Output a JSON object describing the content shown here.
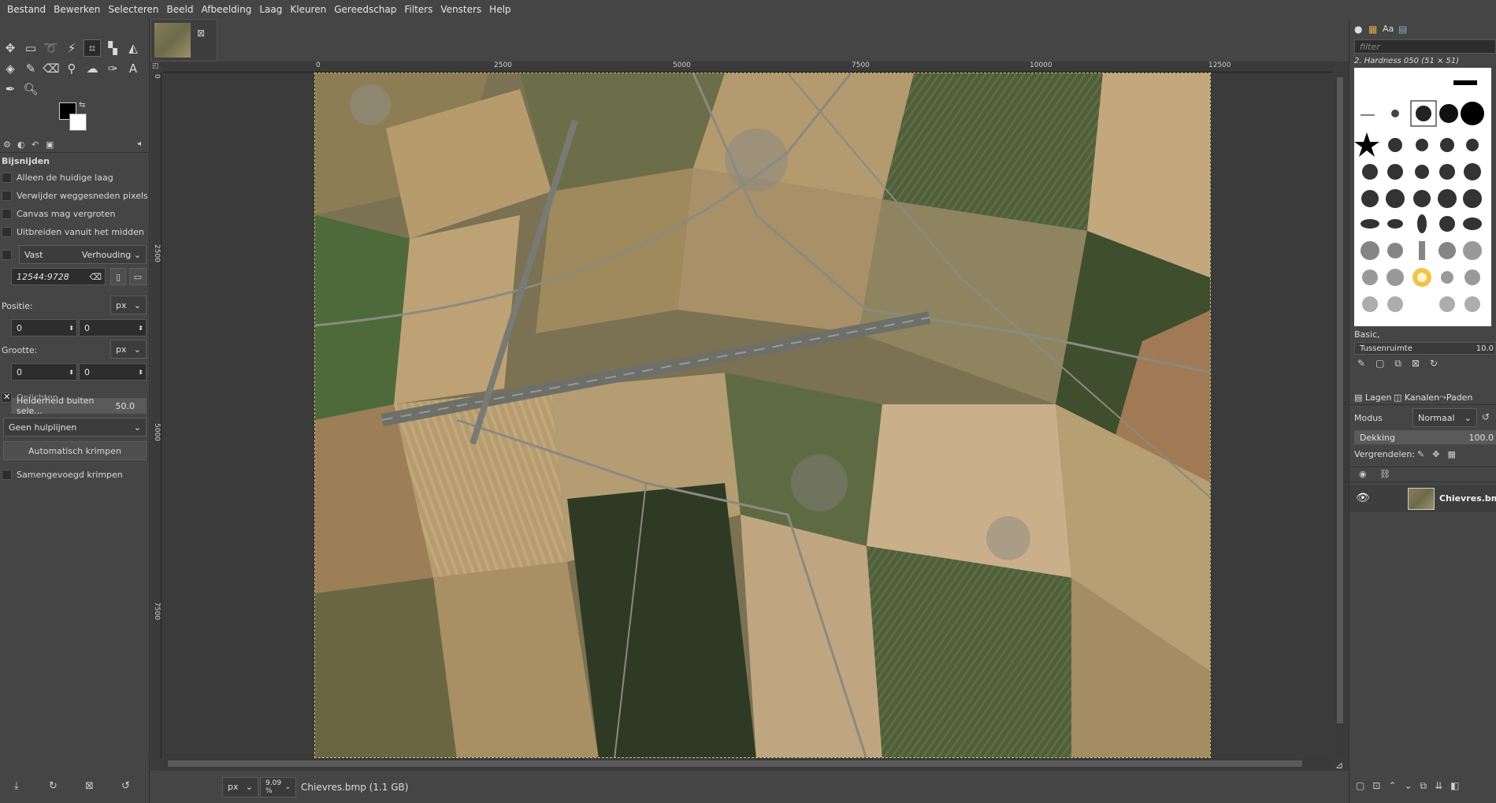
{
  "menu": [
    "Bestand",
    "Bewerken",
    "Selecteren",
    "Beeld",
    "Afbeelding",
    "Laag",
    "Kleuren",
    "Gereedschap",
    "Filters",
    "Vensters",
    "Help"
  ],
  "tool_options": {
    "title": "Bijsnijden",
    "opt_current_layer": "Alleen de huidige laag",
    "opt_delete_pixels": "Verwijder weggesneden pixels",
    "opt_canvas_grow": "Canvas mag vergroten",
    "opt_expand_center": "Uitbreiden vanuit het midden",
    "fixed_label": "Vast",
    "fixed_mode": "Verhouding",
    "ratio_value": "12544:9728",
    "position_label": "Positie:",
    "position_unit": "px",
    "position_x": "0",
    "position_y": "0",
    "size_label": "Grootte:",
    "size_unit": "px",
    "size_w": "0",
    "size_h": "0",
    "highlight_label": "Oplichten",
    "highlight_slider_label": "Helderheid buiten sele...",
    "highlight_value": "50.0",
    "guides": "Geen hulplijnen",
    "auto_shrink": "Automatisch krimpen",
    "merged_shrink": "Samengevoegd krimpen"
  },
  "ruler": {
    "top_labels": [
      "0",
      "2500",
      "5000",
      "7500",
      "10000",
      "12500"
    ],
    "left_labels": [
      "0",
      "2500",
      "5000",
      "7500"
    ]
  },
  "status": {
    "unit": "px",
    "zoom": "9.09 %",
    "file_info": "Chievres.bmp (1.1 GB)"
  },
  "brushes": {
    "filter_placeholder": "filter",
    "brush_name": "2. Hardness 050 (51 × 51)",
    "preset": "Basic,",
    "spacing_label": "Tussenruimte",
    "spacing_value": "10.0"
  },
  "layers": {
    "tab_layers": "Lagen",
    "tab_channels": "Kanalen",
    "tab_paths": "Paden",
    "mode_label": "Modus",
    "mode_value": "Normaal",
    "opacity_label": "Dekking",
    "opacity_value": "100.0",
    "lock_label": "Vergrendelen:",
    "layer_name": "Chievres.bmp"
  }
}
